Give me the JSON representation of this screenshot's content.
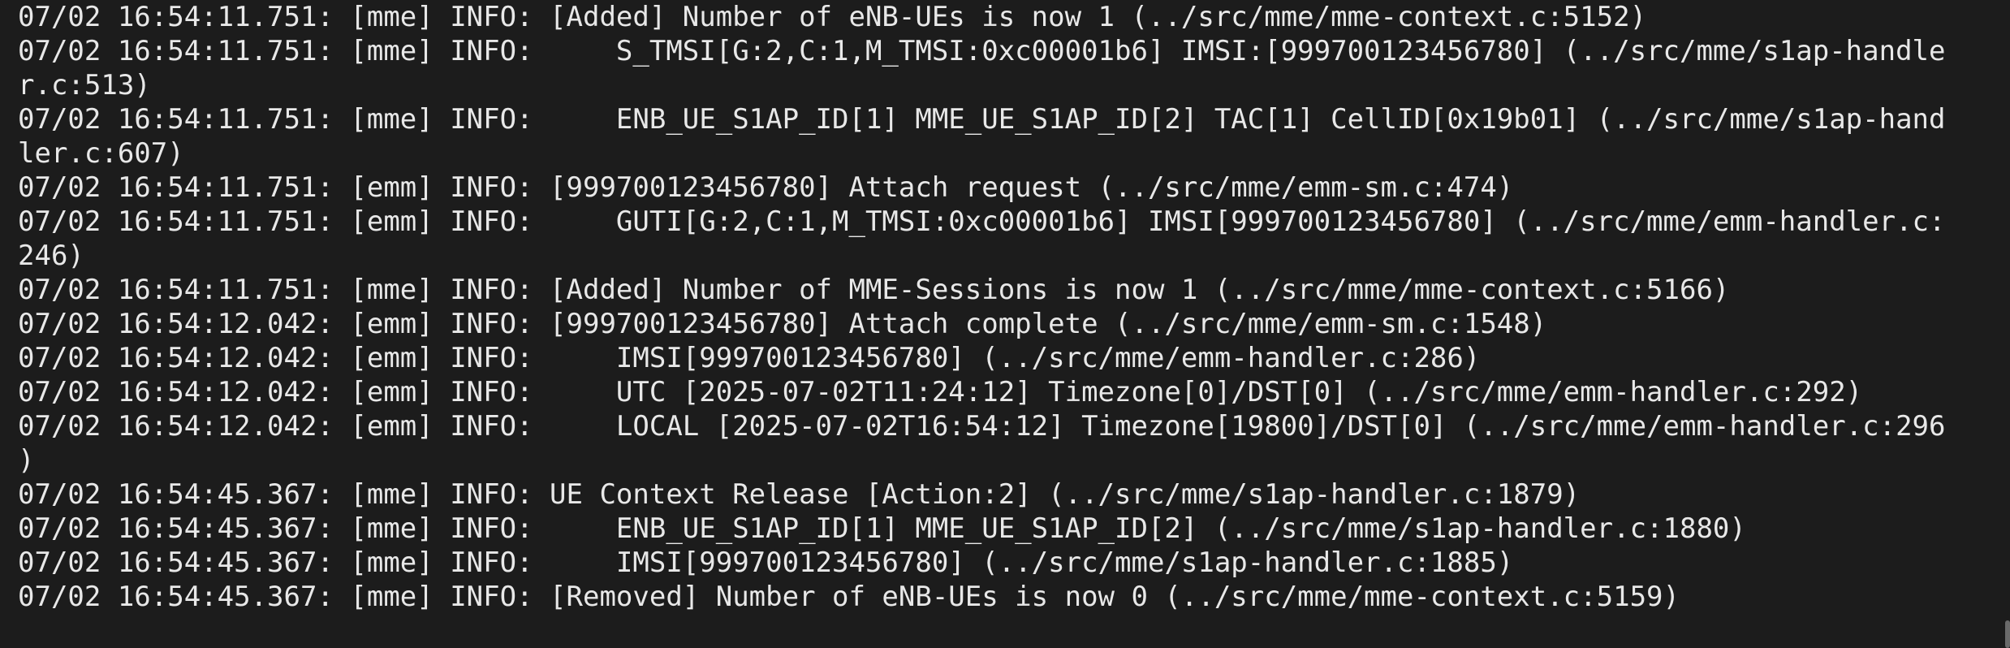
{
  "terminal": {
    "lines": [
      "07/02 16:54:11.751: [mme] INFO: [Added] Number of eNB-UEs is now 1 (../src/mme/mme-context.c:5152)",
      "07/02 16:54:11.751: [mme] INFO:     S_TMSI[G:2,C:1,M_TMSI:0xc00001b6] IMSI:[999700123456780] (../src/mme/s1ap-handle",
      "r.c:513)",
      "07/02 16:54:11.751: [mme] INFO:     ENB_UE_S1AP_ID[1] MME_UE_S1AP_ID[2] TAC[1] CellID[0x19b01] (../src/mme/s1ap-hand",
      "ler.c:607)",
      "07/02 16:54:11.751: [emm] INFO: [999700123456780] Attach request (../src/mme/emm-sm.c:474)",
      "07/02 16:54:11.751: [emm] INFO:     GUTI[G:2,C:1,M_TMSI:0xc00001b6] IMSI[999700123456780] (../src/mme/emm-handler.c:",
      "246)",
      "07/02 16:54:11.751: [mme] INFO: [Added] Number of MME-Sessions is now 1 (../src/mme/mme-context.c:5166)",
      "07/02 16:54:12.042: [emm] INFO: [999700123456780] Attach complete (../src/mme/emm-sm.c:1548)",
      "07/02 16:54:12.042: [emm] INFO:     IMSI[999700123456780] (../src/mme/emm-handler.c:286)",
      "07/02 16:54:12.042: [emm] INFO:     UTC [2025-07-02T11:24:12] Timezone[0]/DST[0] (../src/mme/emm-handler.c:292)",
      "07/02 16:54:12.042: [emm] INFO:     LOCAL [2025-07-02T16:54:12] Timezone[19800]/DST[0] (../src/mme/emm-handler.c:296",
      ")",
      "07/02 16:54:45.367: [mme] INFO: UE Context Release [Action:2] (../src/mme/s1ap-handler.c:1879)",
      "07/02 16:54:45.367: [mme] INFO:     ENB_UE_S1AP_ID[1] MME_UE_S1AP_ID[2] (../src/mme/s1ap-handler.c:1880)",
      "07/02 16:54:45.367: [mme] INFO:     IMSI[999700123456780] (../src/mme/s1ap-handler.c:1885)",
      "07/02 16:54:45.367: [mme] INFO: [Removed] Number of eNB-UEs is now 0 (../src/mme/mme-context.c:5159)"
    ]
  },
  "colors": {
    "background": "#1c1c1c",
    "text": "#e8e8e8",
    "scrollbar": "#6a6a6a"
  }
}
